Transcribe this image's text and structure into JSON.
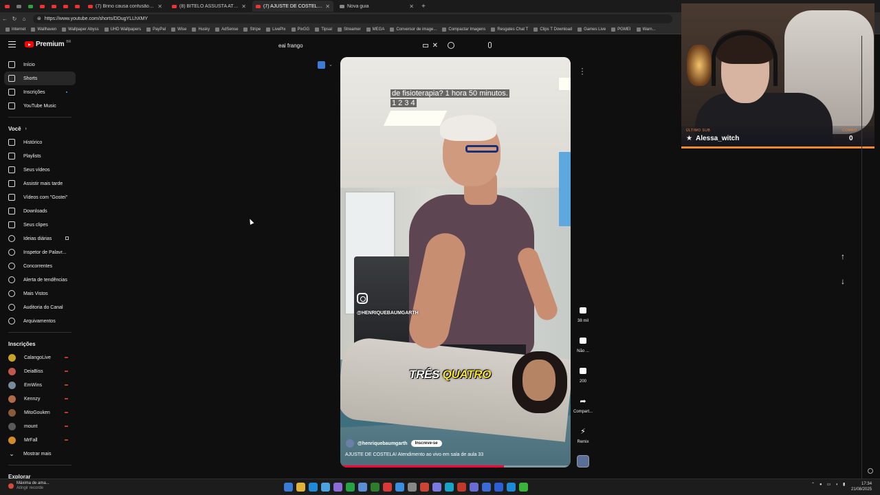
{
  "browser": {
    "tabs": [
      {
        "title": "(7) Brino causa confusão no Rodi..",
        "active": false
      },
      {
        "title": "(8) BITELO ASSUSTA ATENDENTE!...",
        "active": false
      },
      {
        "title": "(7) AJUSTE DE COSTELA! Ate...",
        "active": true
      },
      {
        "title": "Nova guia",
        "active": false
      }
    ],
    "url": "https://www.youtube.com/shorts/DDugYLLhXMY",
    "bookmarks": [
      "Internet",
      "Wallhaven",
      "Wallpaper Abyss",
      "UHD Wallpapers",
      "PayPal",
      "Wise",
      "Husky",
      "AdSense",
      "Stripe",
      "LivePix",
      "PixGG",
      "Tipsal",
      "Streamer",
      "MEGA",
      "Conversor de image...",
      "Compactar Imagens",
      "Resgates Chat T",
      "Clips T Download",
      "Games Live",
      "PGMEI",
      "Warn..."
    ]
  },
  "youtube": {
    "logo_text": "Premium",
    "logo_sup": "BR",
    "search_value": "eai frango"
  },
  "sidebar": {
    "main": [
      {
        "label": "Início",
        "icon": "home-icon",
        "active": false
      },
      {
        "label": "Shorts",
        "icon": "shorts-icon",
        "active": true
      },
      {
        "label": "Inscrições",
        "icon": "subscriptions-icon",
        "active": false
      },
      {
        "label": "YouTube Music",
        "icon": "music-icon",
        "active": false
      }
    ],
    "you_header": "Você",
    "you": [
      {
        "label": "Histórico",
        "icon": "history-icon"
      },
      {
        "label": "Playlists",
        "icon": "playlists-icon"
      },
      {
        "label": "Seus vídeos",
        "icon": "your-videos-icon"
      },
      {
        "label": "Assistir mais tarde",
        "icon": "watch-later-icon"
      },
      {
        "label": "Vídeos com \"Gostei\"",
        "icon": "liked-icon"
      },
      {
        "label": "Downloads",
        "icon": "download-icon"
      },
      {
        "label": "Seus clipes",
        "icon": "clips-icon"
      },
      {
        "label": "Ideias diárias",
        "icon": "ext-icon"
      },
      {
        "label": "Inspetor de Palavr...",
        "icon": "ext-icon"
      },
      {
        "label": "Concorrentes",
        "icon": "ext-icon"
      },
      {
        "label": "Alerta de tendências",
        "icon": "ext-icon"
      },
      {
        "label": "Mais Vistos",
        "icon": "ext-icon"
      },
      {
        "label": "Auditoria do Canal",
        "icon": "ext-icon"
      },
      {
        "label": "Arquivamentos",
        "icon": "ext-icon"
      }
    ],
    "subs_header": "Inscrições",
    "subs": [
      {
        "label": "CalangoLive",
        "color": "#c9a227"
      },
      {
        "label": "DeiaBiss",
        "color": "#c0584d"
      },
      {
        "label": "EmWins",
        "color": "#7a8a9a"
      },
      {
        "label": "Kennzy",
        "color": "#b06a4a"
      },
      {
        "label": "MitoGouken",
        "color": "#8a5a3a"
      },
      {
        "label": "mount",
        "color": "#5a5a5a"
      },
      {
        "label": "MrFall",
        "color": "#d08a2a"
      }
    ],
    "show_more": "Mostrar mais",
    "explore_header": "Explorar"
  },
  "video": {
    "caption_line1": "de fisioterapia? 1 hora 50 minutos.",
    "caption_line2": "1 2 3 4",
    "subtitle_a": "TRÊS ",
    "subtitle_b": "QUATRO",
    "instagram_handle": "@HENRIQUEBAUMGARTH",
    "channel": "@henriquebaumgarth",
    "subscribe_label": "Inscreve-se",
    "title": "AJUSTE DE COSTELA! Atendimento ao vivo em sala de aula 33",
    "progress": 0.71
  },
  "actions": {
    "likes": "38 mil",
    "dislike": "Não ...",
    "comments": "200",
    "share": "Compart...",
    "remix": "Remix"
  },
  "stream_overlay": {
    "label": "ÚLTIMO SUB",
    "name": "Alessa_witch",
    "combo_label": "COMBO",
    "combo_count": "0"
  },
  "taskbar": {
    "weather_line1": "Máxima de ama...",
    "weather_line2": "Atingir recorde",
    "time": "17:34",
    "date": "21/08/2025"
  }
}
